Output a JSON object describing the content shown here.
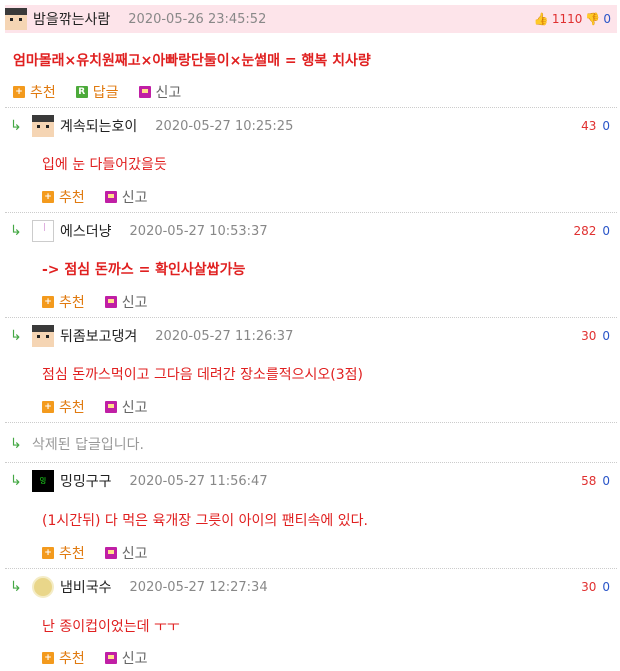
{
  "post": {
    "nick": "밤을깎는사람",
    "date": "2020-05-26 23:45:52",
    "up": "1110",
    "down": "0",
    "content": "엄마몰래×유치원째고×아빠랑단둘이×눈썰매 = 행복 치사량",
    "recommend": "추천",
    "reply": "답글",
    "report": "신고",
    "reply_icon_letter": "R"
  },
  "replies": [
    {
      "nick": "계속되는호이",
      "date": "2020-05-27 10:25:25",
      "up": "43",
      "down": "0",
      "content": "입에 눈 다들어갔을듯",
      "recommend": "추천",
      "report": "신고"
    },
    {
      "nick": "에스더냥",
      "date": "2020-05-27 10:53:37",
      "up": "282",
      "down": "0",
      "content": "-> 점심 돈까스 = 확인사살쌉가능",
      "recommend": "추천",
      "report": "신고"
    },
    {
      "nick": "뒤좀보고댕겨",
      "date": "2020-05-27 11:26:37",
      "up": "30",
      "down": "0",
      "content": "점심 돈까스먹이고 그다음 데려간 장소를적으시오(3점)",
      "recommend": "추천",
      "report": "신고"
    },
    {
      "nick": "밍밍구구",
      "date": "2020-05-27 11:56:47",
      "up": "58",
      "down": "0",
      "content": "(1시간뒤) 다 먹은 육개장 그릇이 아이의 팬티속에 있다.",
      "recommend": "추천",
      "report": "신고",
      "avatar_text": "밍"
    },
    {
      "nick": "냄비국수",
      "date": "2020-05-27 12:27:34",
      "up": "30",
      "down": "0",
      "content": "난 종이컵이었는데 ㅜㅜ",
      "recommend": "추천",
      "report": "신고"
    }
  ],
  "deleted_text": "삭제된 답글입니다.",
  "icons": {
    "reply_arrow": "reply-arrow-icon",
    "thumb_up": "thumb-up-icon",
    "thumb_down": "thumb-down-icon",
    "plus": "plus-icon",
    "report": "report-icon"
  },
  "colors": {
    "header_bg": "#fde4ea",
    "content": "#e02020",
    "up": "#e03030",
    "down": "#2a55c8"
  }
}
